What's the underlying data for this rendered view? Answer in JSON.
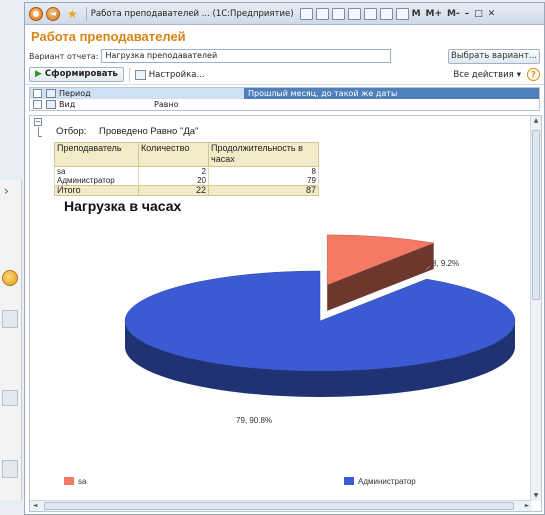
{
  "window": {
    "title": "Работа преподавателей ... (1С:Предприятие)",
    "toolbar_m": "M",
    "toolbar_mplus": "M+",
    "toolbar_mminus": "M-",
    "minimize": "–",
    "restore": "□",
    "close": "✕"
  },
  "form": {
    "title": "Работа преподавателей",
    "variant_label": "Вариант отчета:",
    "variant_value": "Нагрузка преподавателей",
    "variant_button": "Выбрать вариант...",
    "generate_button": "Сформировать",
    "settings_button": "Настройка...",
    "all_actions": "Все действия",
    "help": "?"
  },
  "settings": {
    "rows": [
      {
        "name": "Период",
        "condition": "",
        "value": "Прошлый месяц, до такой же даты",
        "selected": true
      },
      {
        "name": "Вид",
        "condition": "Равно",
        "value": "",
        "selected": false
      }
    ]
  },
  "report": {
    "filter_label": "Отбор:",
    "filter_value": "Проведено Равно \"Да\"",
    "table": {
      "headers": [
        "Преподаватель",
        "Количество",
        "Продолжительность в часах"
      ],
      "rows": [
        {
          "name": "sa",
          "count": "2",
          "hours": "8"
        },
        {
          "name": "Администратор",
          "count": "20",
          "hours": "79"
        }
      ],
      "total": {
        "name": "Итого",
        "count": "22",
        "hours": "87"
      }
    }
  },
  "chart_data": {
    "type": "pie",
    "title": "Нагрузка в часах",
    "categories": [
      "sa",
      "Администратор"
    ],
    "values": [
      8,
      79
    ],
    "labels": [
      "8, 9.2%",
      "79, 90.8%"
    ],
    "colors": [
      "#f47a66",
      "#3a5bd3"
    ],
    "legend_position": "bottom"
  },
  "background": {
    "chevron": "›"
  }
}
